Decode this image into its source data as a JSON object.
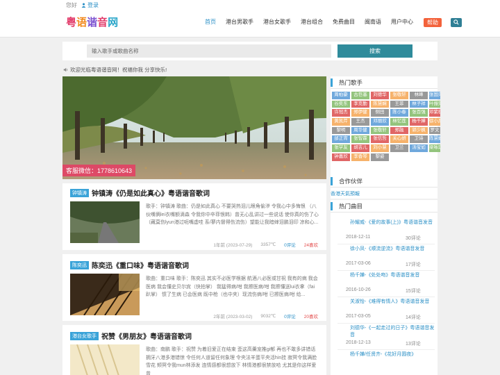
{
  "topbar": {
    "greeting": "您好",
    "login": "登录"
  },
  "logo": [
    "粤",
    "语",
    "谐",
    "音",
    "网"
  ],
  "nav": {
    "items": [
      "首页",
      "港台男歌手",
      "港台女歌手",
      "港台组合",
      "免费曲目",
      "闽南语",
      "用户中心"
    ],
    "active_index": 0,
    "help": "帮助"
  },
  "search": {
    "placeholder": "输入歌手或歌曲名称",
    "button": "搜索"
  },
  "welcome": "欢迎光临粤语谐音网！祝福你我 分享快乐!",
  "hero": {
    "caption": "客服微信：1778610643"
  },
  "articles": [
    {
      "tag": "钟镇涛",
      "title": "钟镇涛《仍是如此真心》粤语谐音歌词",
      "desc": "歌手：钟镇涛 歌曲：仍是如此真心 不要哭热泪儿眼角偷滲 令我心中多悔恨 （八伙嘴俩lei衣嘴额滴森 令我你中卒菲恨韩）曾无心乱讲过一些说话 使你真的伤了心 （藏莫伤lyun港过呃嘴虚哇 系/蓼内督得伤流伤）望能让我暗婶泪鹏泪印 凉和心...",
      "date": "1年前 (2023-07-29)",
      "views": "3357℃",
      "comments": "0评论",
      "likes": "24喜欢"
    },
    {
      "tag": "陈奕迅",
      "title": "陈奕迅《重口味》粤语谐音歌词",
      "desc": "歌曲：重口味 歌手：陈奕迅 其实不必医学根据 航酒八必医或甘祝 我有的病 我会医病 我会懂史贝尔宾（快拍掌） 我猛得病/咁 我擦医病/咁 我擦懂送lui衣拿（fai趴掌） 惯了生病 已会医病 既中枪（也中夹）现流伤病/咁 已擦医病/咁 给...",
      "date": "2年前 (2023-03-02)",
      "views": "9032℃",
      "comments": "0评论",
      "likes": "20喜欢"
    },
    {
      "tag": "港台女歌手",
      "title": "祝赞《男朋友》粤语谐音歌词",
      "desc": "歌曲：南鹏 歌手：祝赞 为着旧爱正在结束 歪这高羹宠推gi郁 再也不敢多讲错话 拥牙八港多港错惊 令任何人道留任何象理 令央法羊蛋平央活hin挂 寂冥令我满脸雪花 颊冥令我mun林添发 连情感都很想放下 林情港都很禁放哈 尤其是你这样爱曾",
      "date": "",
      "views": "",
      "comments": "",
      "likes": ""
    }
  ],
  "sidebar": {
    "hot_singers_title": "热门歌手",
    "singers": [
      "周柏豪",
      "古巨基",
      "刘德华",
      "张敬轩",
      "林峰",
      "张国荣",
      "谷奕东",
      "李克勤",
      "陈慧娴",
      "王菲",
      "林子祥",
      "叶振棠",
      "许冠杰",
      "郑伊健",
      "侧田",
      "陈小春",
      "张百强",
      "邓紫棋",
      "黄凯芹",
      "王杰",
      "邓丽欣",
      "林忆莲",
      "杨千嬅",
      "徐小凤",
      "黎明",
      "周华健",
      "张敬轩",
      "郑融",
      "郭少枫",
      "罗文",
      "邰正宵",
      "张智霖",
      "张信哲",
      "关心妍",
      "卫诗",
      "陈慧娴",
      "张学友",
      "胡吉儿",
      "刘小慧",
      "卫兰",
      "汤宝如",
      "梁咏琪",
      "钟嘉欣",
      "李香琴",
      "黎姿"
    ],
    "singer_colors": [
      "#6fa8dc",
      "#93c47d",
      "#e06666",
      "#f6b26b",
      "#999999",
      "#6fa8dc",
      "#93c47d",
      "#e06666",
      "#f6b26b",
      "#999999",
      "#6fa8dc",
      "#93c47d",
      "#e06666",
      "#f6b26b",
      "#999999",
      "#6fa8dc",
      "#93c47d",
      "#e06666",
      "#f6b26b",
      "#999999",
      "#6fa8dc",
      "#93c47d",
      "#e06666",
      "#f6b26b",
      "#999999",
      "#6fa8dc",
      "#93c47d",
      "#e06666",
      "#f6b26b",
      "#999999",
      "#6fa8dc",
      "#93c47d",
      "#e06666",
      "#f6b26b",
      "#999999",
      "#6fa8dc",
      "#93c47d",
      "#e06666",
      "#f6b26b",
      "#999999",
      "#6fa8dc",
      "#93c47d",
      "#e06666",
      "#f6b26b",
      "#999999"
    ],
    "partners_title": "合作伙伴",
    "partner_link": "香港天氣預報",
    "hot_songs_title": "热门曲目",
    "songs": [
      {
        "title": "孙耀威-《爱的故事(上)》粤语谐音发音",
        "date": "2018-12-11",
        "count": "30评论"
      },
      {
        "title": "徐小凤-《顺流逆流》粤语谐音发音",
        "date": "2017-03-06",
        "count": "17评论"
      },
      {
        "title": "杨千嬅-《处处吻》粤语谐音发音",
        "date": "2016-10-26",
        "count": "15评论"
      },
      {
        "title": "关淑怡-《难得有情人》粤语谐音发音",
        "date": "2017-03-05",
        "count": "14评论"
      },
      {
        "title": "刘德华-《一起走过的日子》粤语谐音发音",
        "date": "2018-12-13",
        "count": "13评论"
      },
      {
        "title": "杨千嬅/任贤齐-《花好月圆夜》",
        "date": "",
        "count": ""
      }
    ]
  }
}
